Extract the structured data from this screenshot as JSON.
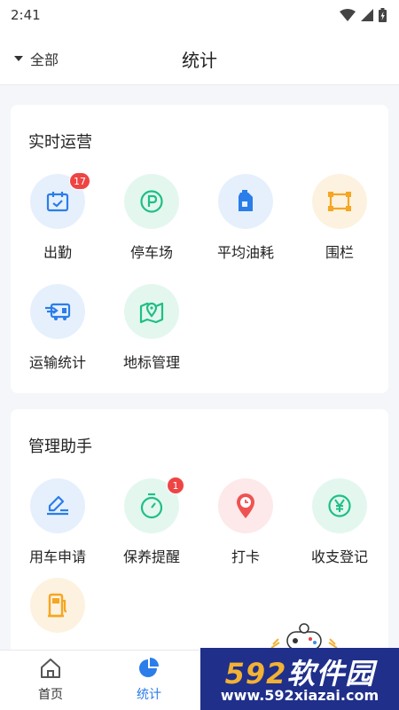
{
  "status_bar": {
    "time": "2:41"
  },
  "header": {
    "filter_label": "全部",
    "title": "统计"
  },
  "sections": [
    {
      "title": "实时运营",
      "items": [
        {
          "label": "出勤",
          "icon": "calendar-check-icon",
          "badge": "17"
        },
        {
          "label": "停车场",
          "icon": "parking-icon"
        },
        {
          "label": "平均油耗",
          "icon": "fuel-can-icon"
        },
        {
          "label": "围栏",
          "icon": "fence-icon"
        },
        {
          "label": "运输统计",
          "icon": "transport-truck-icon"
        },
        {
          "label": "地标管理",
          "icon": "map-pin-icon"
        }
      ]
    },
    {
      "title": "管理助手",
      "items": [
        {
          "label": "用车申请",
          "icon": "edit-pen-icon"
        },
        {
          "label": "保养提醒",
          "icon": "timer-icon",
          "badge": "1"
        },
        {
          "label": "打卡",
          "icon": "location-clock-icon"
        },
        {
          "label": "收支登记",
          "icon": "yen-coin-icon"
        },
        {
          "label": "",
          "icon": "fuel-pump-icon"
        }
      ]
    }
  ],
  "tabbar": {
    "tabs": [
      {
        "label": "首页",
        "icon": "home-icon",
        "active": false
      },
      {
        "label": "统计",
        "icon": "pie-chart-icon",
        "active": true
      }
    ]
  },
  "watermark": {
    "brand_num": "592",
    "brand_text": "软件园",
    "url": "www.592xiazai.com"
  },
  "colors": {
    "accent": "#2b7de9",
    "green": "#1fbf84",
    "orange": "#f5a623",
    "red": "#ef5350",
    "badge": "#ef4444"
  }
}
